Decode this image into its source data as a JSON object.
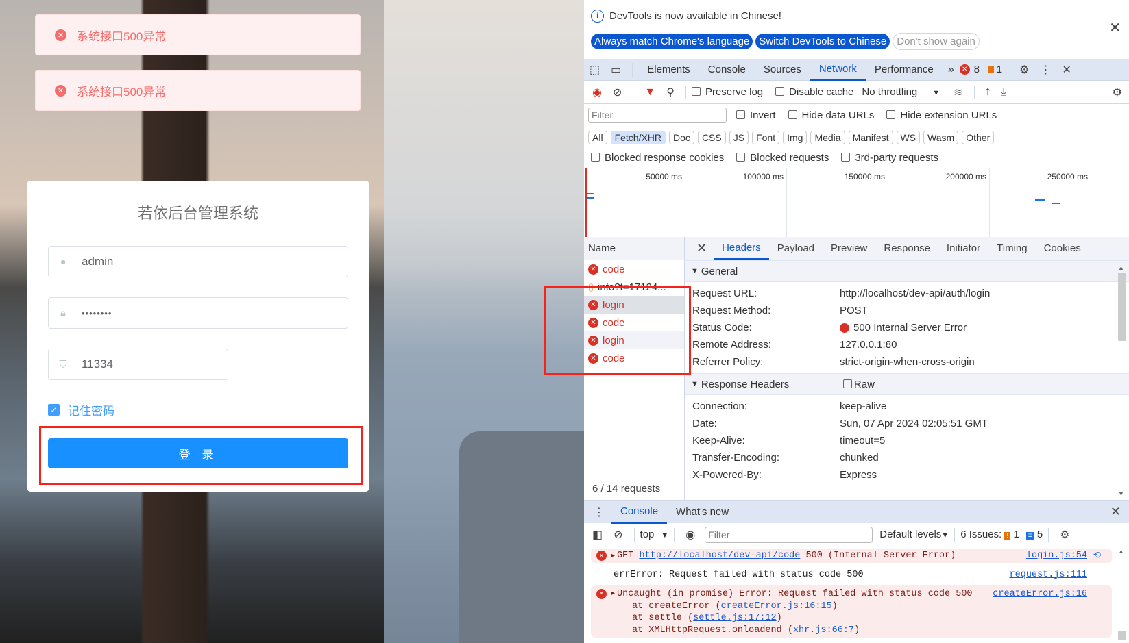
{
  "page": {
    "toasts": [
      {
        "icon": "error-circle-icon",
        "text": "系统接口500异常"
      },
      {
        "icon": "error-circle-icon",
        "text": "系统接口500异常"
      }
    ],
    "login_card": {
      "title": "若依后台管理系统",
      "username": "admin",
      "password": "••••••••",
      "captcha": "11334",
      "remember_label": "记住密码",
      "remember_checked": true,
      "login_button": "登 录"
    }
  },
  "devtools": {
    "banner": {
      "text": "DevTools is now available in Chinese!",
      "buttons": [
        "Always match Chrome's language",
        "Switch DevTools to Chinese",
        "Don't show again"
      ]
    },
    "tabs": [
      "Elements",
      "Console",
      "Sources",
      "Network",
      "Performance"
    ],
    "active_tab": "Network",
    "error_count": "8",
    "warning_count": "1",
    "toolbar": {
      "preserve_log": "Preserve log",
      "disable_cache": "Disable cache",
      "throttling": "No throttling"
    },
    "filter": {
      "placeholder": "Filter",
      "invert": "Invert",
      "hide_data_urls": "Hide data URLs",
      "hide_extension_urls": "Hide extension URLs"
    },
    "types": [
      "All",
      "Fetch/XHR",
      "Doc",
      "CSS",
      "JS",
      "Font",
      "Img",
      "Media",
      "Manifest",
      "WS",
      "Wasm",
      "Other"
    ],
    "selected_type": "Fetch/XHR",
    "blocked": [
      "Blocked response cookies",
      "Blocked requests",
      "3rd-party requests"
    ],
    "timeline_ticks": [
      "50000 ms",
      "100000 ms",
      "150000 ms",
      "200000 ms",
      "250000 ms"
    ],
    "name_header": "Name",
    "requests": [
      "code",
      "info?t=17124...",
      "login",
      "code",
      "login",
      "code"
    ],
    "request_count": "6 / 14 requests",
    "detail_tabs": [
      "Headers",
      "Payload",
      "Preview",
      "Response",
      "Initiator",
      "Timing",
      "Cookies"
    ],
    "general": {
      "title": "General",
      "rows": [
        [
          "Request URL:",
          "http://localhost/dev-api/auth/login"
        ],
        [
          "Request Method:",
          "POST"
        ],
        [
          "Status Code:",
          "500 Internal Server Error"
        ],
        [
          "Remote Address:",
          "127.0.0.1:80"
        ],
        [
          "Referrer Policy:",
          "strict-origin-when-cross-origin"
        ]
      ]
    },
    "response_headers": {
      "title": "Response Headers",
      "raw": "Raw",
      "rows": [
        [
          "Connection:",
          "keep-alive"
        ],
        [
          "Date:",
          "Sun, 07 Apr 2024 02:05:51 GMT"
        ],
        [
          "Keep-Alive:",
          "timeout=5"
        ],
        [
          "Transfer-Encoding:",
          "chunked"
        ],
        [
          "X-Powered-By:",
          "Express"
        ]
      ]
    },
    "drawer": {
      "tabs": [
        "Console",
        "What's new"
      ],
      "context": "top",
      "filter_placeholder": "Filter",
      "levels": "Default levels",
      "issues_label": "6 Issues:",
      "issues_warn": "1",
      "issues_info": "5",
      "messages": {
        "m1": {
          "prefix": "GET ",
          "url": "http://localhost/dev-api/code",
          "rest": " 500 (Internal Server Error)",
          "source": "login.js:54"
        },
        "m2": {
          "text": "errError: Request failed with status code 500",
          "source": "request.js:111"
        },
        "m3": {
          "text": "Uncaught (in promise) Error: Request failed with status code 500",
          "source": "createError.js:16",
          "stack": [
            [
              "at createError (",
              "createError.js:16:15",
              ")"
            ],
            [
              "at settle (",
              "settle.js:17:12",
              ")"
            ],
            [
              "at XMLHttpRequest.onloadend (",
              "xhr.js:66:7",
              ")"
            ]
          ]
        }
      }
    }
  }
}
